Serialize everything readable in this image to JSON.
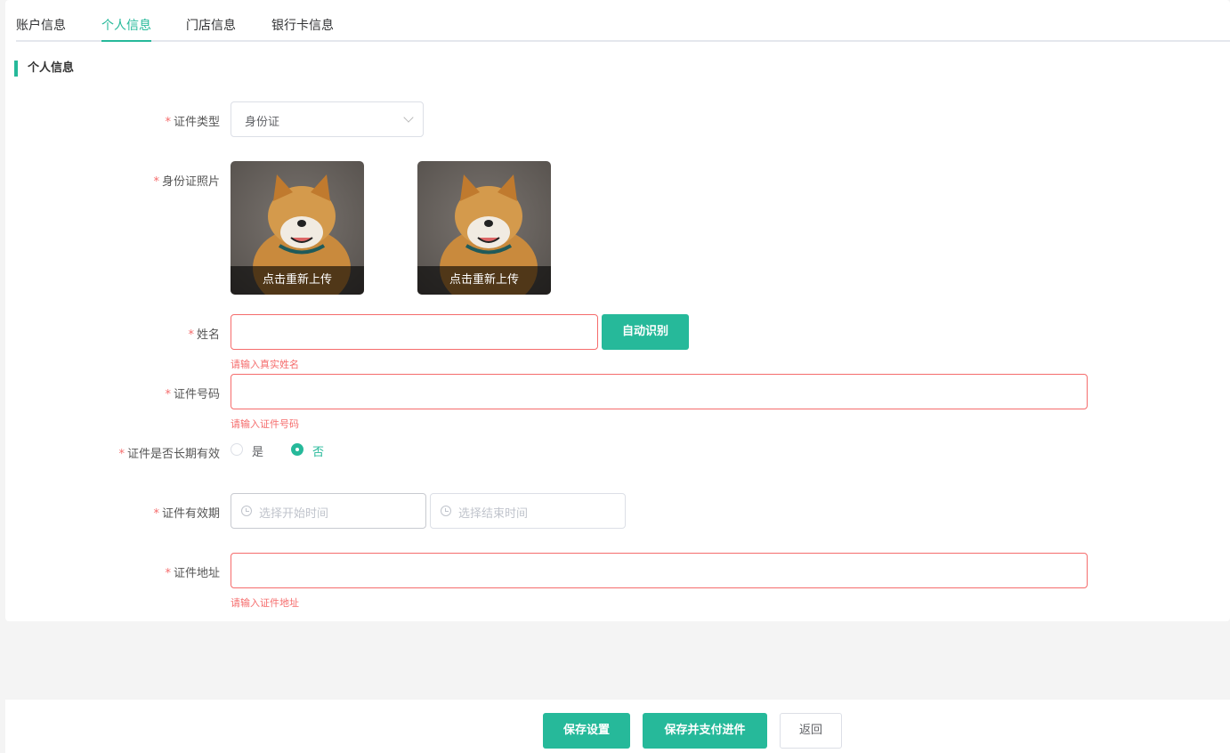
{
  "tabs": [
    {
      "label": "账户信息"
    },
    {
      "label": "个人信息"
    },
    {
      "label": "门店信息"
    },
    {
      "label": "银行卡信息"
    }
  ],
  "section_title": "个人信息",
  "form": {
    "id_type": {
      "label": "证件类型",
      "value": "身份证"
    },
    "id_photo": {
      "label": "身份证照片",
      "reupload": "点击重新上传"
    },
    "name": {
      "label": "姓名",
      "value": "",
      "error": "请输入真实姓名",
      "auto_button": "自动识别"
    },
    "id_number": {
      "label": "证件号码",
      "value": "",
      "error": "请输入证件号码"
    },
    "long_term": {
      "label": "证件是否长期有效",
      "options": [
        "是",
        "否"
      ],
      "selected": "否"
    },
    "validity": {
      "label": "证件有效期",
      "start_placeholder": "选择开始时间",
      "end_placeholder": "选择结束时间"
    },
    "address": {
      "label": "证件地址",
      "value": "",
      "error": "请输入证件地址"
    }
  },
  "footer": {
    "save": "保存设置",
    "save_pay": "保存并支付进件",
    "back": "返回"
  },
  "colors": {
    "accent": "#26b99a",
    "error": "#f56c6c"
  }
}
